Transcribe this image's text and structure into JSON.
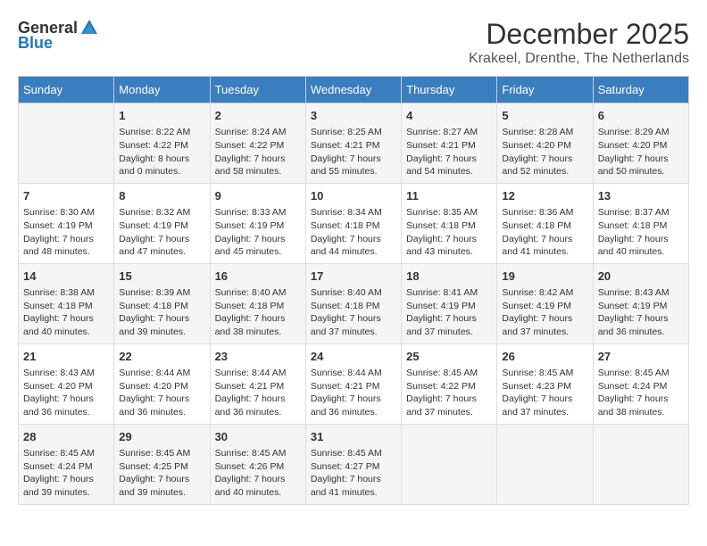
{
  "logo": {
    "general": "General",
    "blue": "Blue"
  },
  "title": {
    "month": "December 2025",
    "location": "Krakeel, Drenthe, The Netherlands"
  },
  "weekdays": [
    "Sunday",
    "Monday",
    "Tuesday",
    "Wednesday",
    "Thursday",
    "Friday",
    "Saturday"
  ],
  "weeks": [
    [
      {
        "day": "",
        "sunrise": "",
        "sunset": "",
        "daylight": ""
      },
      {
        "day": "1",
        "sunrise": "Sunrise: 8:22 AM",
        "sunset": "Sunset: 4:22 PM",
        "daylight": "Daylight: 8 hours and 0 minutes."
      },
      {
        "day": "2",
        "sunrise": "Sunrise: 8:24 AM",
        "sunset": "Sunset: 4:22 PM",
        "daylight": "Daylight: 7 hours and 58 minutes."
      },
      {
        "day": "3",
        "sunrise": "Sunrise: 8:25 AM",
        "sunset": "Sunset: 4:21 PM",
        "daylight": "Daylight: 7 hours and 55 minutes."
      },
      {
        "day": "4",
        "sunrise": "Sunrise: 8:27 AM",
        "sunset": "Sunset: 4:21 PM",
        "daylight": "Daylight: 7 hours and 54 minutes."
      },
      {
        "day": "5",
        "sunrise": "Sunrise: 8:28 AM",
        "sunset": "Sunset: 4:20 PM",
        "daylight": "Daylight: 7 hours and 52 minutes."
      },
      {
        "day": "6",
        "sunrise": "Sunrise: 8:29 AM",
        "sunset": "Sunset: 4:20 PM",
        "daylight": "Daylight: 7 hours and 50 minutes."
      }
    ],
    [
      {
        "day": "7",
        "sunrise": "Sunrise: 8:30 AM",
        "sunset": "Sunset: 4:19 PM",
        "daylight": "Daylight: 7 hours and 48 minutes."
      },
      {
        "day": "8",
        "sunrise": "Sunrise: 8:32 AM",
        "sunset": "Sunset: 4:19 PM",
        "daylight": "Daylight: 7 hours and 47 minutes."
      },
      {
        "day": "9",
        "sunrise": "Sunrise: 8:33 AM",
        "sunset": "Sunset: 4:19 PM",
        "daylight": "Daylight: 7 hours and 45 minutes."
      },
      {
        "day": "10",
        "sunrise": "Sunrise: 8:34 AM",
        "sunset": "Sunset: 4:18 PM",
        "daylight": "Daylight: 7 hours and 44 minutes."
      },
      {
        "day": "11",
        "sunrise": "Sunrise: 8:35 AM",
        "sunset": "Sunset: 4:18 PM",
        "daylight": "Daylight: 7 hours and 43 minutes."
      },
      {
        "day": "12",
        "sunrise": "Sunrise: 8:36 AM",
        "sunset": "Sunset: 4:18 PM",
        "daylight": "Daylight: 7 hours and 41 minutes."
      },
      {
        "day": "13",
        "sunrise": "Sunrise: 8:37 AM",
        "sunset": "Sunset: 4:18 PM",
        "daylight": "Daylight: 7 hours and 40 minutes."
      }
    ],
    [
      {
        "day": "14",
        "sunrise": "Sunrise: 8:38 AM",
        "sunset": "Sunset: 4:18 PM",
        "daylight": "Daylight: 7 hours and 40 minutes."
      },
      {
        "day": "15",
        "sunrise": "Sunrise: 8:39 AM",
        "sunset": "Sunset: 4:18 PM",
        "daylight": "Daylight: 7 hours and 39 minutes."
      },
      {
        "day": "16",
        "sunrise": "Sunrise: 8:40 AM",
        "sunset": "Sunset: 4:18 PM",
        "daylight": "Daylight: 7 hours and 38 minutes."
      },
      {
        "day": "17",
        "sunrise": "Sunrise: 8:40 AM",
        "sunset": "Sunset: 4:18 PM",
        "daylight": "Daylight: 7 hours and 37 minutes."
      },
      {
        "day": "18",
        "sunrise": "Sunrise: 8:41 AM",
        "sunset": "Sunset: 4:19 PM",
        "daylight": "Daylight: 7 hours and 37 minutes."
      },
      {
        "day": "19",
        "sunrise": "Sunrise: 8:42 AM",
        "sunset": "Sunset: 4:19 PM",
        "daylight": "Daylight: 7 hours and 37 minutes."
      },
      {
        "day": "20",
        "sunrise": "Sunrise: 8:43 AM",
        "sunset": "Sunset: 4:19 PM",
        "daylight": "Daylight: 7 hours and 36 minutes."
      }
    ],
    [
      {
        "day": "21",
        "sunrise": "Sunrise: 8:43 AM",
        "sunset": "Sunset: 4:20 PM",
        "daylight": "Daylight: 7 hours and 36 minutes."
      },
      {
        "day": "22",
        "sunrise": "Sunrise: 8:44 AM",
        "sunset": "Sunset: 4:20 PM",
        "daylight": "Daylight: 7 hours and 36 minutes."
      },
      {
        "day": "23",
        "sunrise": "Sunrise: 8:44 AM",
        "sunset": "Sunset: 4:21 PM",
        "daylight": "Daylight: 7 hours and 36 minutes."
      },
      {
        "day": "24",
        "sunrise": "Sunrise: 8:44 AM",
        "sunset": "Sunset: 4:21 PM",
        "daylight": "Daylight: 7 hours and 36 minutes."
      },
      {
        "day": "25",
        "sunrise": "Sunrise: 8:45 AM",
        "sunset": "Sunset: 4:22 PM",
        "daylight": "Daylight: 7 hours and 37 minutes."
      },
      {
        "day": "26",
        "sunrise": "Sunrise: 8:45 AM",
        "sunset": "Sunset: 4:23 PM",
        "daylight": "Daylight: 7 hours and 37 minutes."
      },
      {
        "day": "27",
        "sunrise": "Sunrise: 8:45 AM",
        "sunset": "Sunset: 4:24 PM",
        "daylight": "Daylight: 7 hours and 38 minutes."
      }
    ],
    [
      {
        "day": "28",
        "sunrise": "Sunrise: 8:45 AM",
        "sunset": "Sunset: 4:24 PM",
        "daylight": "Daylight: 7 hours and 39 minutes."
      },
      {
        "day": "29",
        "sunrise": "Sunrise: 8:45 AM",
        "sunset": "Sunset: 4:25 PM",
        "daylight": "Daylight: 7 hours and 39 minutes."
      },
      {
        "day": "30",
        "sunrise": "Sunrise: 8:45 AM",
        "sunset": "Sunset: 4:26 PM",
        "daylight": "Daylight: 7 hours and 40 minutes."
      },
      {
        "day": "31",
        "sunrise": "Sunrise: 8:45 AM",
        "sunset": "Sunset: 4:27 PM",
        "daylight": "Daylight: 7 hours and 41 minutes."
      },
      {
        "day": "",
        "sunrise": "",
        "sunset": "",
        "daylight": ""
      },
      {
        "day": "",
        "sunrise": "",
        "sunset": "",
        "daylight": ""
      },
      {
        "day": "",
        "sunrise": "",
        "sunset": "",
        "daylight": ""
      }
    ]
  ]
}
